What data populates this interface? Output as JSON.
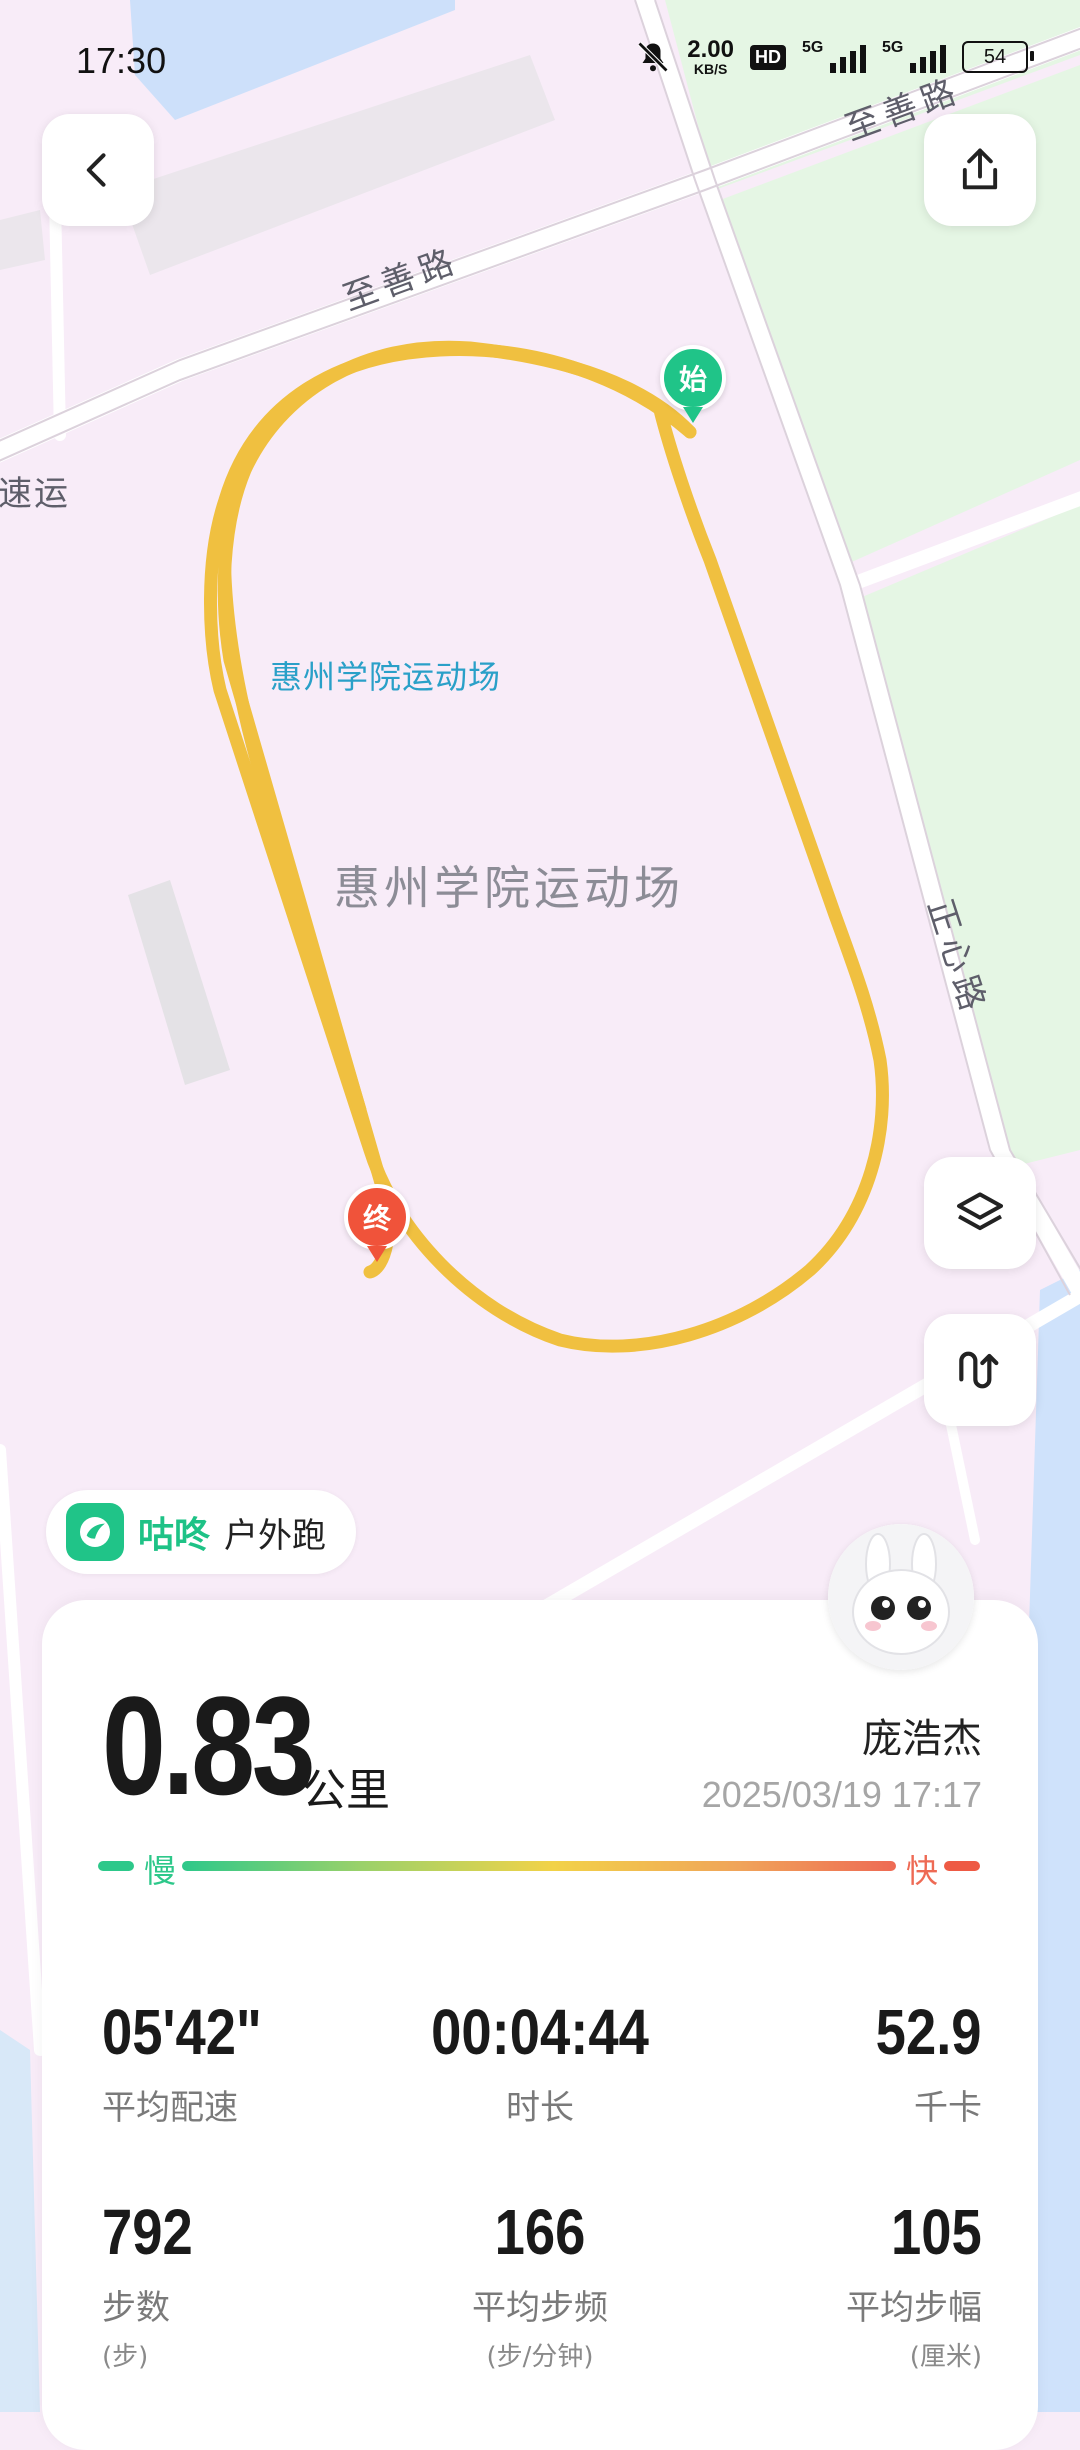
{
  "status_bar": {
    "time": "17:30",
    "net_speed_value": "2.00",
    "net_speed_unit": "KB/S",
    "hd_label": "HD",
    "signal1_label": "5G",
    "signal2_label": "5G",
    "battery_level": "54",
    "icons": [
      "mute-bell-icon",
      "signal-icon",
      "battery-icon"
    ]
  },
  "map": {
    "road_labels": {
      "zhishan_road_1": "至善路",
      "zhishan_road_2": "至善路",
      "zhengxin_road": "正心路",
      "partial_label": "速运"
    },
    "venue_label_small": "惠州学院运动场",
    "venue_label_large": "惠州学院运动场",
    "start_marker": "始",
    "end_marker": "终",
    "colors": {
      "track": "#f0c040",
      "start": "#20c488",
      "end": "#f0533a",
      "land": "#f8ecf8",
      "green": "#e6f6e6",
      "water": "#cfe2fb"
    }
  },
  "buttons": {
    "back": "back-icon",
    "share": "share-icon",
    "layers": "layers-icon",
    "route": "route-icon"
  },
  "app": {
    "name": "咕咚",
    "mode": "户外跑"
  },
  "summary": {
    "distance": "0.83",
    "distance_unit": "公里",
    "user_name": "庞浩杰",
    "datetime": "2025/03/19 17:17",
    "pace_scale": {
      "slow": "慢",
      "fast": "快"
    }
  },
  "stats": [
    {
      "value": "05'42\"",
      "label": "平均配速",
      "sub": ""
    },
    {
      "value": "00:04:44",
      "label": "时长",
      "sub": ""
    },
    {
      "value": "52.9",
      "label": "千卡",
      "sub": ""
    },
    {
      "value": "792",
      "label": "步数",
      "sub": "(步)"
    },
    {
      "value": "166",
      "label": "平均步频",
      "sub": "(步/分钟)"
    },
    {
      "value": "105",
      "label": "平均步幅",
      "sub": "(厘米)"
    }
  ]
}
